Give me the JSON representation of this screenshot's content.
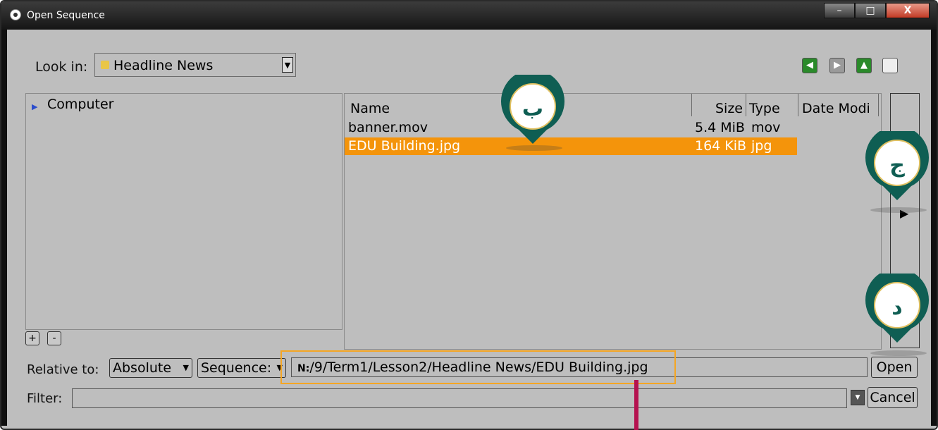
{
  "window": {
    "title": "Open Sequence",
    "controls": {
      "minimize": "–",
      "maximize": "□",
      "close": "X"
    }
  },
  "toolbar": {
    "look_in_label": "Look in:",
    "look_in_value": "Headline News",
    "buttons": [
      "back-icon",
      "forward-icon",
      "up-folder-icon",
      "new-folder-icon"
    ]
  },
  "sidebar": {
    "items": [
      {
        "label": "Computer",
        "icon": "computer-icon"
      }
    ],
    "add_label": "+",
    "remove_label": "-"
  },
  "file_list": {
    "columns": [
      "Name",
      "Size",
      "Type",
      "Date Modi"
    ],
    "rows": [
      {
        "name": "banner.mov",
        "size": "5.4 MiB",
        "type": "mov",
        "selected": false
      },
      {
        "name": "EDU Building.jpg",
        "size": "164 KiB",
        "type": "jpg",
        "selected": true
      }
    ],
    "selection_color": "#f4940b"
  },
  "right_pane": {
    "arrow": "▶"
  },
  "bottom": {
    "relative_to_label": "Relative to:",
    "relative_to_value": "Absolute",
    "sequence_value": "Sequence:",
    "path_drive": "N:",
    "path_rest": "/9/Term1/Lesson2/Headline News/EDU Building.jpg",
    "filter_label": "Filter:",
    "filter_value": "",
    "open_label": "Open",
    "cancel_label": "Cancel"
  },
  "annotations": {
    "markers": [
      {
        "letter": "ب",
        "color": "#0f5e53"
      },
      {
        "letter": "ج",
        "color": "#0f5e53"
      },
      {
        "letter": "د",
        "color": "#0f5e53"
      }
    ],
    "highlight_color": "#f5a623",
    "pointer_color": "#b5124f"
  }
}
